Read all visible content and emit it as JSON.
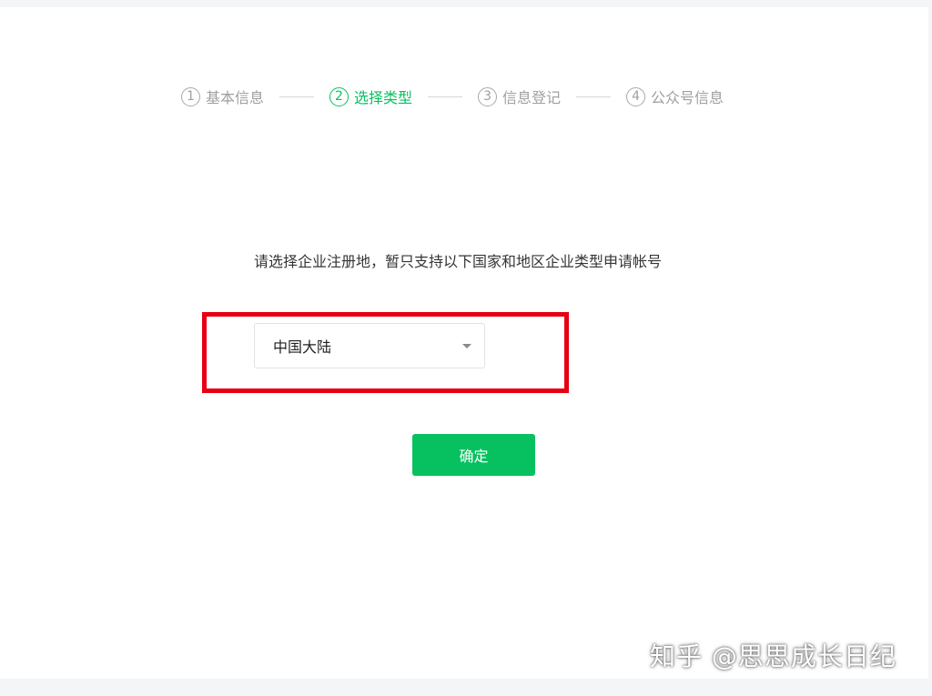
{
  "steps": [
    {
      "num": "1",
      "label": "基本信息",
      "active": false
    },
    {
      "num": "2",
      "label": "选择类型",
      "active": true
    },
    {
      "num": "3",
      "label": "信息登记",
      "active": false
    },
    {
      "num": "4",
      "label": "公众号信息",
      "active": false
    }
  ],
  "notice": "请选择企业注册地，暂只支持以下国家和地区企业类型申请帐号",
  "region_select": {
    "value": "中国大陆"
  },
  "confirm_button": "确定",
  "watermark": "知乎 @思思成长日纪",
  "colors": {
    "accent": "#07c160",
    "highlight": "#e60012"
  }
}
